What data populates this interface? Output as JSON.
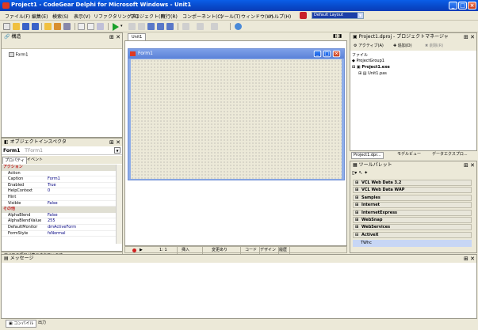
{
  "window": {
    "title": "Project1 - CodeGear Delphi for Microsoft Windows - Unit1"
  },
  "menu": [
    "ファイル(F)",
    "編集(E)",
    "検索(S)",
    "表示(V)",
    "リファクタリング(R)",
    "プロジェクト(P)",
    "実行(R)",
    "コンポーネント(C)",
    "ツール(T)",
    "ウィンドウ(W)",
    "ヘルプ(H)"
  ],
  "layout_combo": "Default Layout",
  "structure": {
    "title": "構造",
    "tree_item": "Form1"
  },
  "designer": {
    "tab": "Unit1",
    "form_caption": "Form1",
    "status": [
      "1: 1",
      "挿入",
      "変更あり"
    ],
    "tabs": [
      "コード",
      "デザイン",
      "履歴"
    ]
  },
  "inspector": {
    "title": "オブジェクトインスペクタ",
    "object_name": "Form1",
    "object_type": "TForm1",
    "tabs": [
      "プロパティ",
      "イベント"
    ],
    "rows": [
      {
        "cat": true,
        "name": "アクション"
      },
      {
        "name": "Action",
        "value": ""
      },
      {
        "name": "Caption",
        "value": "Form1"
      },
      {
        "name": "Enabled",
        "value": "True"
      },
      {
        "name": "HelpContext",
        "value": "0"
      },
      {
        "name": "Hint",
        "value": ""
      },
      {
        "name": "Visible",
        "value": "False"
      },
      {
        "cat": true,
        "name": "その他"
      },
      {
        "name": "AlphaBlend",
        "value": "False"
      },
      {
        "name": "AlphaBlendValue",
        "value": "255"
      },
      {
        "name": "DefaultMonitor",
        "value": "dmActiveForm"
      },
      {
        "name": "FormStyle",
        "value": "fsNormal"
      }
    ],
    "status": "すべての項目が表示されています"
  },
  "project_manager": {
    "title": "Project1.dproj - プロジェクトマネージャ",
    "toolbar": [
      "アクティブ(A)",
      "追加(D)",
      "削除(R)"
    ],
    "header": "ファイル",
    "tree": [
      "ProjectGroup1",
      "Project1.exe",
      "Unit1.pas"
    ],
    "tabs": [
      "Project1.dpr...",
      "モデルビュー",
      "データエクスプロ..."
    ]
  },
  "palette": {
    "title": "ツールパレット",
    "items": [
      "VCL Web Data 3.2",
      "VCL Web Data WAP",
      "Samples",
      "Internet",
      "InternetExpress",
      "WebSnap",
      "WebServices",
      "ActiveX"
    ],
    "subitem": "TWhc"
  },
  "messages": {
    "title": "メッセージ",
    "tabs": [
      "コンパイル",
      "出力"
    ]
  }
}
